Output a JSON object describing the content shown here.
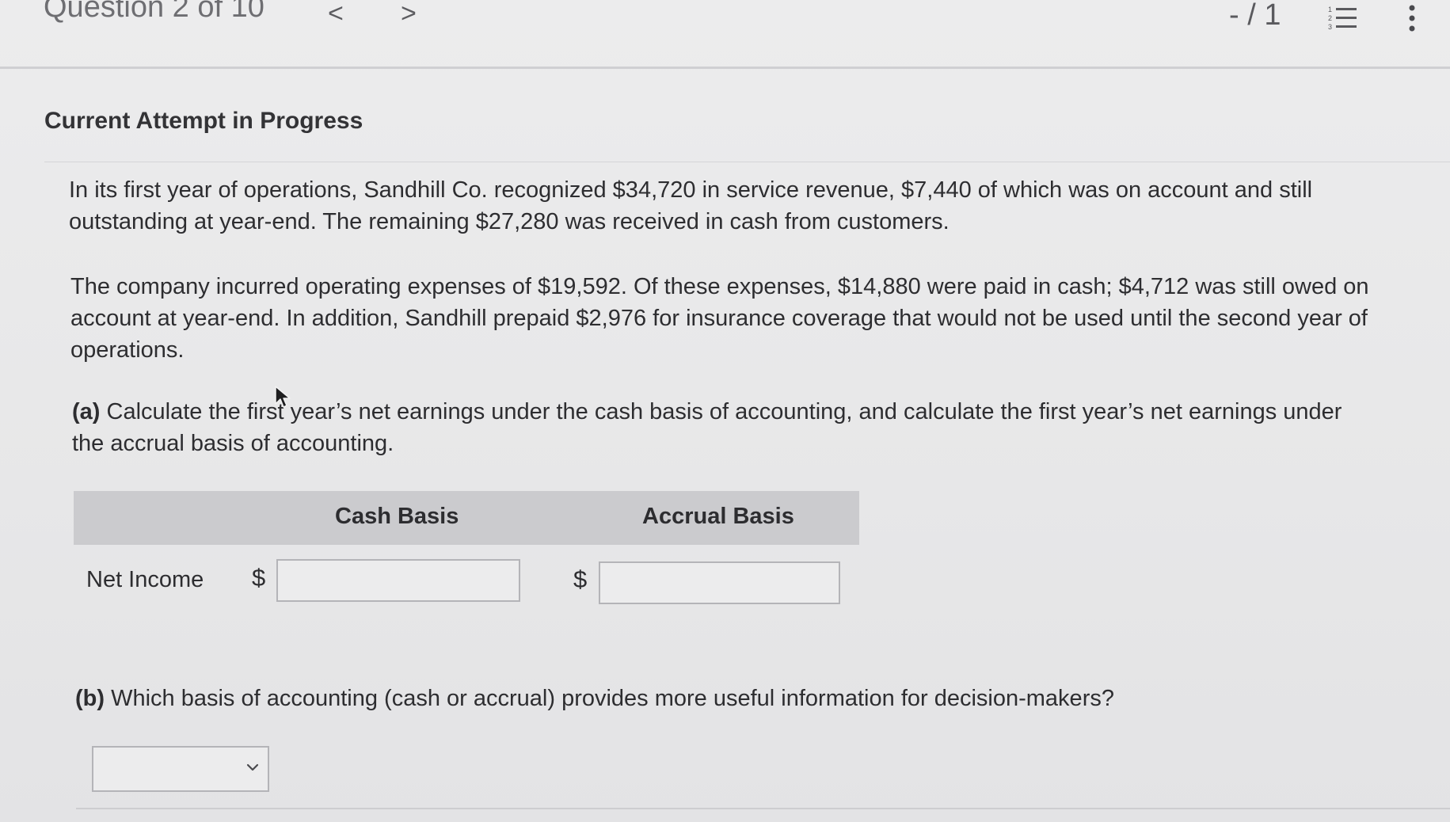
{
  "header": {
    "question_label": "Question 2 of 10",
    "prev_glyph": "<",
    "next_glyph": ">",
    "score": "- / 1",
    "list_icon": "numbered-list-icon",
    "more_icon": "more-vertical-icon"
  },
  "section": {
    "title": "Current Attempt in Progress"
  },
  "problem": {
    "p1": "In its first year of operations, Sandhill Co. recognized $34,720 in service revenue, $7,440 of which was on account and still outstanding at year-end. The remaining $27,280 was received in cash from customers.",
    "p2": "The company incurred operating expenses of $19,592. Of these expenses, $14,880 were paid in cash; $4,712 was still owed on account at year-end. In addition, Sandhill prepaid $2,976 for insurance coverage that would not be used until the second year of operations.",
    "part_a_label": "(a)",
    "part_a_text": "Calculate the first year’s net earnings under the cash basis of accounting, and calculate the first year’s net earnings under the accrual basis of accounting.",
    "part_b_label": "(b)",
    "part_b_text": "Which basis of accounting (cash or accrual) provides more useful information for decision-makers?"
  },
  "table": {
    "columns": [
      "Cash Basis",
      "Accrual Basis"
    ],
    "row_label": "Net Income",
    "currency": "$",
    "cash_value": "",
    "accrual_value": ""
  },
  "dropdown": {
    "selected": ""
  }
}
